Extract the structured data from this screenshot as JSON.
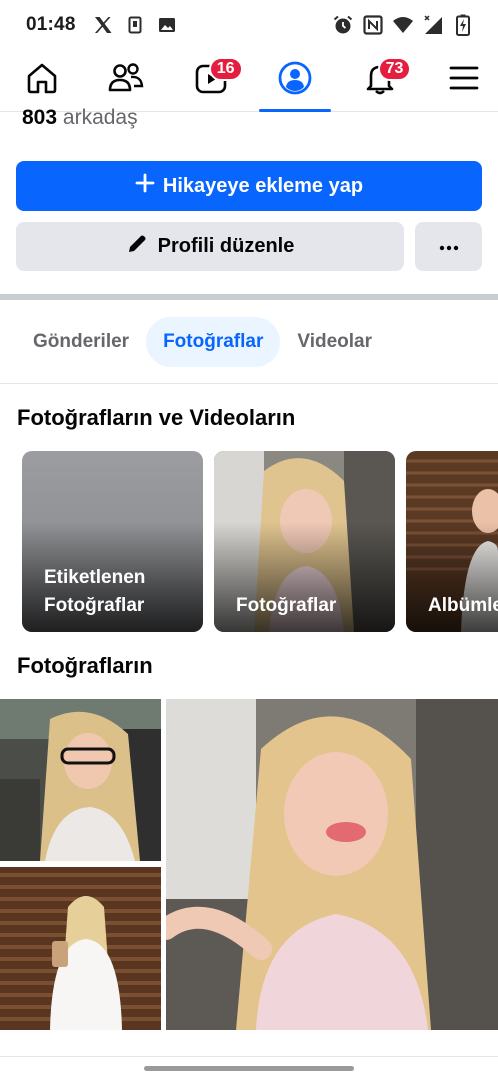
{
  "status_bar": {
    "time": "01:48",
    "left_icons": [
      "x-app-icon",
      "sim-icon",
      "image-icon"
    ],
    "right_icons": [
      "alarm-icon",
      "nfc-icon",
      "wifi-icon",
      "signal-icon",
      "battery-icon"
    ]
  },
  "nav": {
    "items": [
      {
        "name": "home",
        "icon": "home-icon",
        "badge": ""
      },
      {
        "name": "friends",
        "icon": "friends-icon",
        "badge": ""
      },
      {
        "name": "video",
        "icon": "video-icon",
        "badge": "16"
      },
      {
        "name": "profile",
        "icon": "profile-icon",
        "badge": ""
      },
      {
        "name": "notifications",
        "icon": "bell-icon",
        "badge": "73"
      },
      {
        "name": "menu",
        "icon": "menu-icon",
        "badge": ""
      }
    ],
    "active": "profile",
    "accent": "#0866ff",
    "badge_color": "#e41e3f"
  },
  "profile": {
    "friends_count": "803",
    "friends_label": "arkadaş"
  },
  "actions": {
    "add_story_label": "Hikayeye ekleme yap",
    "edit_profile_label": "Profili düzenle",
    "more_label": "···"
  },
  "tabs": [
    {
      "label": "Gönderiler",
      "active": false
    },
    {
      "label": "Fotoğraflar",
      "active": true
    },
    {
      "label": "Videolar",
      "active": false
    }
  ],
  "albums_section": {
    "title": "Fotoğrafların ve Videoların",
    "albums": [
      {
        "label_line1": "Etiketlenen",
        "label_line2": "Fotoğraflar"
      },
      {
        "label_line1": "",
        "label_line2": "Fotoğraflar"
      },
      {
        "label_line1": "",
        "label_line2": "Albümle"
      }
    ]
  },
  "photos_section": {
    "title": "Fotoğrafların"
  }
}
